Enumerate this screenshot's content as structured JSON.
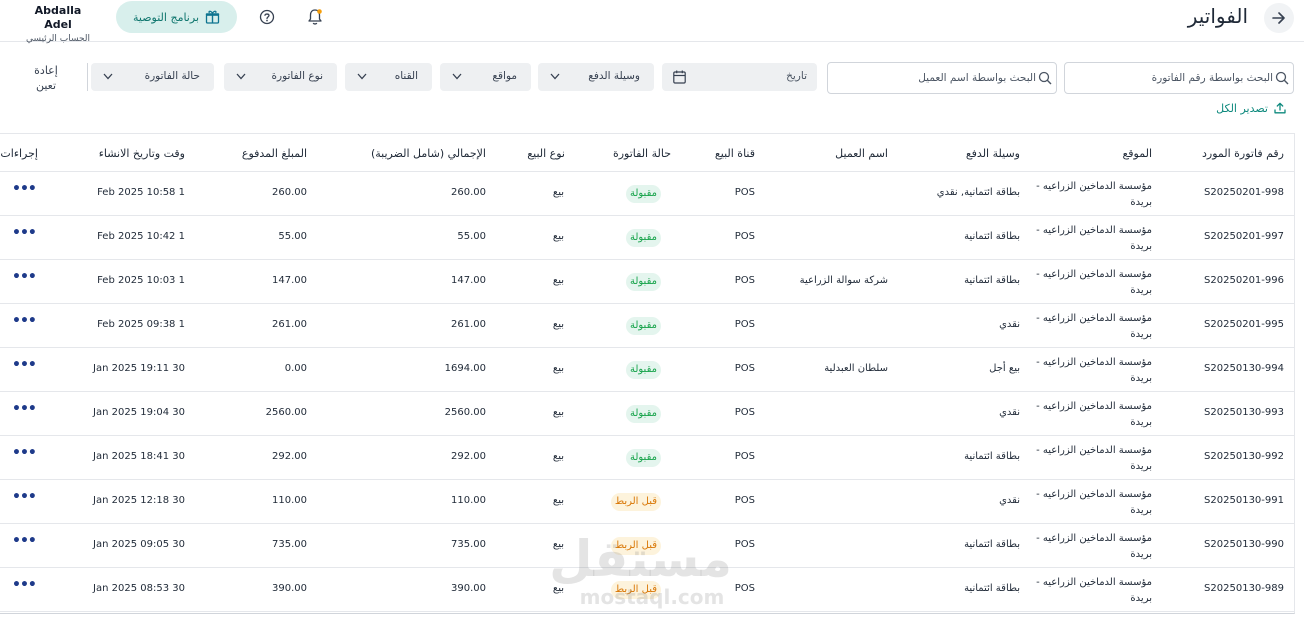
{
  "header": {
    "title": "الفواتير",
    "user_name": "Abdalla Adel",
    "user_account": "الحساب الرئيسي",
    "referral_label": "برنامج التوصية"
  },
  "filters": {
    "invoice_search_placeholder": "البحث بواسطة رقم الفاتورة",
    "customer_search_placeholder": "البحث بواسطة اسم العميل",
    "date_label": "تاريخ",
    "payment_method": "وسيلة الدفع",
    "locations": "مواقع",
    "channel": "القناه",
    "invoice_type": "نوع الفاتورة",
    "invoice_status": "حالة الفاتورة",
    "reset_line1": "إعادة",
    "reset_line2": "تعين",
    "export_all": "تصدير الكل"
  },
  "table": {
    "headers": {
      "supplier_invoice_no": "رقم فاتورة المورد",
      "location": "الموقع",
      "payment_method": "وسيلة الدفع",
      "customer_name": "اسم العميل",
      "sales_channel": "قناة البيع",
      "invoice_status": "حالة الفاتورة",
      "sale_type": "نوع البيع",
      "total_incl_tax": "الإجمالي (شامل الضريبة)",
      "paid_amount": "المبلغ المدفوع",
      "created_at": "وقت وتاريخ الانشاء",
      "actions": "إجراءات"
    },
    "rows": [
      {
        "id": "S20250201-998",
        "location": "مؤسسة الدماخين الزراعيه - بريدة",
        "payment": "بطاقة ائتمانية, نقدي",
        "customer": "",
        "channel": "POS",
        "status": "مقبولة",
        "status_type": "ok",
        "sale_type": "بيع",
        "total": "260.00",
        "paid": "260.00",
        "created": "1 Feb 2025 10:58"
      },
      {
        "id": "S20250201-997",
        "location": "مؤسسة الدماخين الزراعيه - بريدة",
        "payment": "بطاقة ائتمانية",
        "customer": "",
        "channel": "POS",
        "status": "مقبولة",
        "status_type": "ok",
        "sale_type": "بيع",
        "total": "55.00",
        "paid": "55.00",
        "created": "1 Feb 2025 10:42"
      },
      {
        "id": "S20250201-996",
        "location": "مؤسسة الدماخين الزراعيه - بريدة",
        "payment": "بطاقة ائتمانية",
        "customer": "شركة سوالة الزراعية",
        "channel": "POS",
        "status": "مقبولة",
        "status_type": "ok",
        "sale_type": "بيع",
        "total": "147.00",
        "paid": "147.00",
        "created": "1 Feb 2025 10:03"
      },
      {
        "id": "S20250201-995",
        "location": "مؤسسة الدماخين الزراعيه - بريدة",
        "payment": "نقدي",
        "customer": "",
        "channel": "POS",
        "status": "مقبولة",
        "status_type": "ok",
        "sale_type": "بيع",
        "total": "261.00",
        "paid": "261.00",
        "created": "1 Feb 2025 09:38"
      },
      {
        "id": "S20250130-994",
        "location": "مؤسسة الدماخين الزراعيه - بريدة",
        "payment": "بيع أجل",
        "customer": "سلطان العبدلية",
        "channel": "POS",
        "status": "مقبولة",
        "status_type": "ok",
        "sale_type": "بيع",
        "total": "1694.00",
        "paid": "0.00",
        "created": "30 Jan 2025 19:11"
      },
      {
        "id": "S20250130-993",
        "location": "مؤسسة الدماخين الزراعيه - بريدة",
        "payment": "نقدي",
        "customer": "",
        "channel": "POS",
        "status": "مقبولة",
        "status_type": "ok",
        "sale_type": "بيع",
        "total": "2560.00",
        "paid": "2560.00",
        "created": "30 Jan 2025 19:04"
      },
      {
        "id": "S20250130-992",
        "location": "مؤسسة الدماخين الزراعيه - بريدة",
        "payment": "بطاقة ائتمانية",
        "customer": "",
        "channel": "POS",
        "status": "مقبولة",
        "status_type": "ok",
        "sale_type": "بيع",
        "total": "292.00",
        "paid": "292.00",
        "created": "30 Jan 2025 18:41"
      },
      {
        "id": "S20250130-991",
        "location": "مؤسسة الدماخين الزراعيه - بريدة",
        "payment": "نقدي",
        "customer": "",
        "channel": "POS",
        "status": "قبل الربط",
        "status_type": "pend",
        "sale_type": "بيع",
        "total": "110.00",
        "paid": "110.00",
        "created": "30 Jan 2025 12:18"
      },
      {
        "id": "S20250130-990",
        "location": "مؤسسة الدماخين الزراعيه - بريدة",
        "payment": "بطاقة ائتمانية",
        "customer": "",
        "channel": "POS",
        "status": "قبل الربط",
        "status_type": "pend",
        "sale_type": "بيع",
        "total": "735.00",
        "paid": "735.00",
        "created": "30 Jan 2025 09:05"
      },
      {
        "id": "S20250130-989",
        "location": "مؤسسة الدماخين الزراعيه - بريدة",
        "payment": "بطاقة ائتمانية",
        "customer": "",
        "channel": "POS",
        "status": "قبل الربط",
        "status_type": "pend",
        "sale_type": "بيع",
        "total": "390.00",
        "paid": "390.00",
        "created": "30 Jan 2025 08:53"
      }
    ]
  },
  "watermark": {
    "main": "مستقل",
    "sub": "mostaql.com"
  }
}
